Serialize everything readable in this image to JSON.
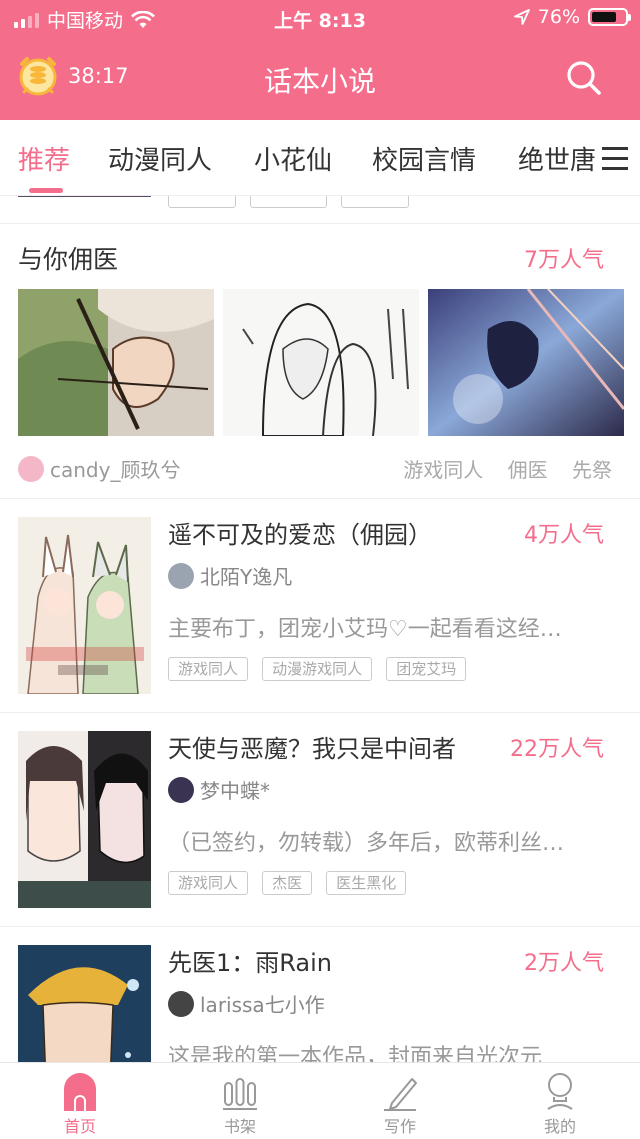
{
  "status_bar": {
    "carrier": "中国移动",
    "time": "上午 8:13",
    "battery": "76%",
    "battery_level": 0.76
  },
  "header": {
    "timer": "38:17",
    "title": "话本小说",
    "icons": [
      "alarm-coin-icon",
      "search-icon"
    ]
  },
  "tabs": [
    {
      "label": "推荐",
      "active": true
    },
    {
      "label": "动漫同人",
      "active": false
    },
    {
      "label": "小花仙",
      "active": false
    },
    {
      "label": "校园言情",
      "active": false
    },
    {
      "label": "绝世唐",
      "active": false
    }
  ],
  "featured": {
    "title": "与你佣医",
    "popularity": "7万人气",
    "author": "candy_顾玖兮",
    "tags": [
      "游戏同人",
      "佣医",
      "先祭"
    ]
  },
  "stories": [
    {
      "title": "遥不可及的爱恋（佣园）",
      "popularity": "4万人气",
      "author": "北陌Y逸凡",
      "description": "主要布丁，团宠小艾玛♡一起看看这经…",
      "tags": [
        "游戏同人",
        "动漫游戏同人",
        "团宠艾玛"
      ]
    },
    {
      "title": "天使与恶魔？我只是中间者",
      "popularity": "22万人气",
      "author": "梦中蝶*",
      "description": "（已签约，勿转载）多年后，欧蒂利丝…",
      "tags": [
        "游戏同人",
        "杰医",
        "医生黑化"
      ]
    },
    {
      "title": "先医1：雨Rain",
      "popularity": "2万人气",
      "author": "larissa七小作",
      "description": "这是我的第一本作品，封面来自光次元",
      "tags": []
    }
  ],
  "bottom_nav": [
    {
      "label": "首页",
      "icon": "home-icon",
      "active": true
    },
    {
      "label": "书架",
      "icon": "bookshelf-icon",
      "active": false
    },
    {
      "label": "写作",
      "icon": "pen-icon",
      "active": false
    },
    {
      "label": "我的",
      "icon": "profile-icon",
      "active": false
    }
  ],
  "colors": {
    "brand": "#f46e8c",
    "text": "#333333",
    "muted": "#999999"
  }
}
